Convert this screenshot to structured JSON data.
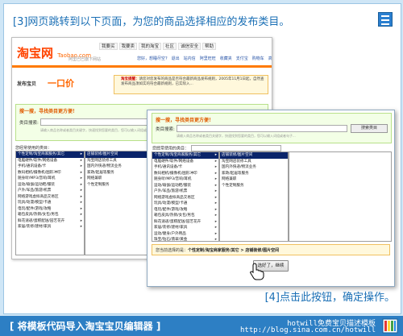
{
  "step3_text": "[3]网页跳转到以下页面，为您的商品选择相应的发布类目。",
  "step4_text": "[4]点击此按钮，确定操作。",
  "back_page": {
    "logo_text": "淘宝网",
    "logo_domain": "Taobao.com",
    "logo_tagline": "阿里巴巴旗下网站",
    "top_nav": [
      "我要买",
      "我要卖",
      "我的淘宝",
      "社区",
      "诚信安全",
      "帮助"
    ],
    "sub_nav": [
      "您好，想睡尽空?",
      "退出",
      "站内信",
      "阿里旺旺",
      "收藏夹",
      "支付宝",
      "购物车",
      "高级搜索"
    ],
    "publish_label": "发布宝贝",
    "price_mode": "一口价",
    "notice_title": "淘宝提醒：",
    "notice_text": "请您对您发布的商品是否符合最新商品发布规则，2005年11月1日起，自然查发布商品须如实的符合最新规则，已实际入...",
    "search_heading": "搜一搜，寻找类目更方便！",
    "search_label": "类目搜索:",
    "search_hint": "请输入商品名称或者类目关键字，快速找到您要的类目，您可以输入词组或者句子...",
    "recent_label": "您经常使用的类目：",
    "columns": [
      {
        "items": [
          "个性定制/淘宝商家服务/其它",
          "电脑硬件/软件/网络设备",
          "手机/通讯设备/卡",
          "数码相机/摄像机/图形冲印",
          "随身听/MP3/音响/耳机",
          "运动/瑜伽/运动鞋/服装",
          "户外/军品/旅游/机票",
          "网络游戏虚拟商品交易区",
          "玩具/动漫/模型/卡通",
          "电玩/配件/游戏/攻略",
          "箱包皮具/热销/女包/男包",
          "鲜花速递/蛋糕配送/园艺花卉",
          "家居/装修/建材/家具"
        ],
        "selected_index": 0
      },
      {
        "items": [
          "店铺装修/图片空间",
          "淘宝网店装修工具",
          "国内外快递/物流业务",
          "家政/起居等服务",
          "网络兼职",
          "个性定制服务"
        ],
        "selected_index": 0
      }
    ]
  },
  "front_page": {
    "search_heading": "搜一搜，寻找类目更方便！",
    "search_label": "类目搜索:",
    "search_button": "搜索类目",
    "search_hint": "请输入商品名称或者类目关键字，快速找到您要的类目，您可以输入词组或者句子...",
    "recent_label": "您经常使用的类目：",
    "columns": [
      {
        "items": [
          "个性定制/淘宝商家服务/其它",
          "电脑硬件/软件/网络设备",
          "手机/通讯设备/卡",
          "数码相机/摄像机/图形冲印",
          "随身听/MP3/音响/耳机",
          "运动/瑜伽/运动鞋/服装",
          "户外/军品/旅游/机票",
          "网络游戏虚拟商品交易区",
          "玩具/动漫/模型/卡通",
          "电玩/配件/游戏/攻略",
          "箱包皮具/热销/女包/男包",
          "鲜花速递/蛋糕配送/园艺花卉",
          "家居/装修/建材/家具",
          "运动/健身/户外用品",
          "珠宝/钻石/翡翠/黄金"
        ],
        "selected_index": 0
      },
      {
        "items": [
          "店铺装修/图片空间",
          "淘宝网店装修工具",
          "国内外快递/物流业务",
          "家政/起居等服务",
          "网络兼职",
          "个性定制服务"
        ],
        "selected_index": 0
      }
    ],
    "selected_prefix": "您当前选择的是：",
    "selected_path": "个性定制/淘宝商家服务/其它 > 店铺装修/图片空间",
    "next_button": "选好了，继续"
  },
  "footer": {
    "left_text": "[ 将模板代码导入淘宝宝贝编辑器 ]",
    "right_line1": "hotwill免费宝贝描述模板",
    "right_line2": "http://blog.sina.com.cn/hotwill"
  },
  "colors": {
    "accent_blue": "#1a6fb5",
    "footer_blue": "#2d7fc4",
    "taobao_orange": "#ff4400",
    "selection_navy": "#0a246a"
  }
}
